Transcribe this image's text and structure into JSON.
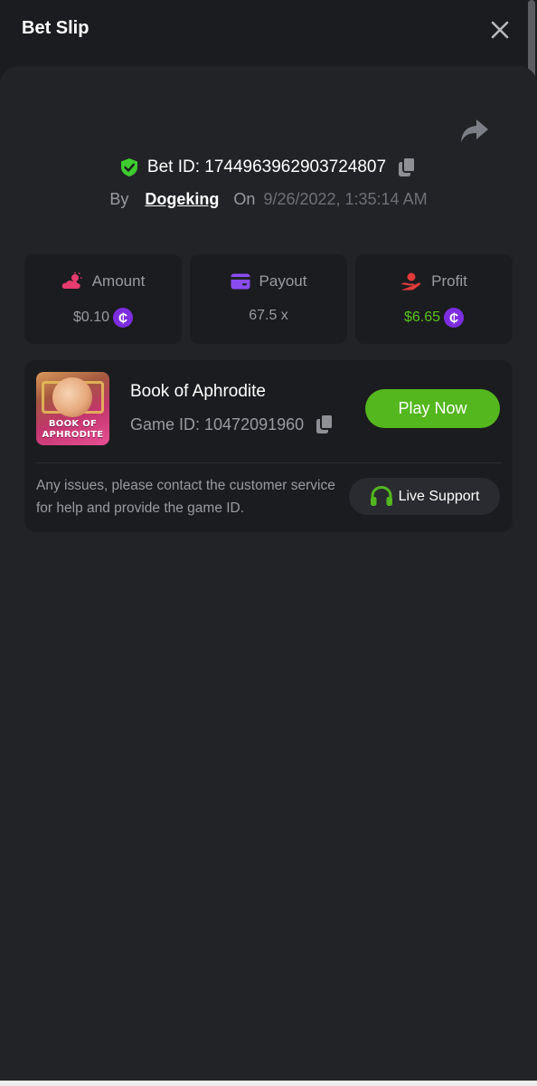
{
  "header": {
    "title": "Bet Slip"
  },
  "bet": {
    "id_label": "Bet ID: 1744963962903724807",
    "by_label": "By",
    "username": "Dogeking",
    "on_label": "On",
    "date": "9/26/2022, 1:35:14 AM"
  },
  "stats": {
    "amount": {
      "label": "Amount",
      "value": "$0.10",
      "coin_symbol": "₵"
    },
    "payout": {
      "label": "Payout",
      "value": "67.5 x"
    },
    "profit": {
      "label": "Profit",
      "value": "$6.65",
      "coin_symbol": "₵"
    }
  },
  "game": {
    "name": "Book of Aphrodite",
    "id_label": "Game ID: 10472091960",
    "thumb_line1": "BOOK OF",
    "thumb_line2": "APHRODITE",
    "play_label": "Play Now",
    "notice": "Any issues, please contact the customer service for help and provide the game ID.",
    "support_label": "Live Support"
  },
  "colors": {
    "background": "#1b1c1f",
    "panel": "#222327",
    "accent_green": "#53b71d",
    "profit_green": "#5ac41f",
    "coin_purple": "#7d2de0",
    "amount_pink": "#e53b6f",
    "payout_purple": "#8a4cf0",
    "profit_red": "#e03a3a",
    "muted_text": "#9a9ba1"
  },
  "icons": {
    "close": "close-icon",
    "share": "share-icon",
    "verified": "shield-check-icon",
    "copy": "copy-icon",
    "amount": "cloud-sun-icon",
    "payout": "wallet-card-icon",
    "profit": "hand-user-icon",
    "support": "headset-icon"
  }
}
